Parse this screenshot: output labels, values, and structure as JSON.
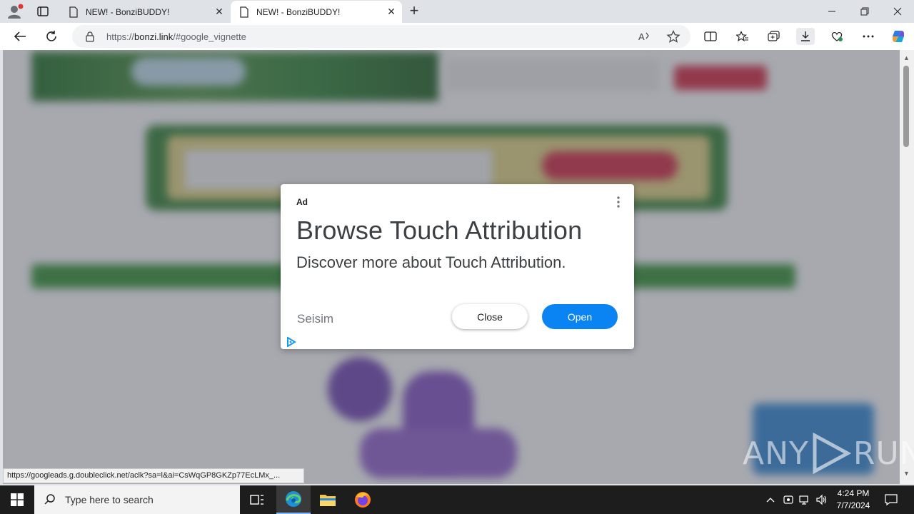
{
  "browser": {
    "tabs": [
      {
        "title": "NEW! - BonziBUDDY!",
        "active": false
      },
      {
        "title": "NEW! - BonziBUDDY!",
        "active": true
      }
    ],
    "url_host": "bonzi.link",
    "url_prefix": "https://",
    "url_rest": "/#google_vignette",
    "status_link": "https://googleads.g.doubleclick.net/aclk?sa=l&ai=CsWqGP8GKZp77EcLMx_..."
  },
  "ad": {
    "label": "Ad",
    "headline": "Browse Touch Attribution",
    "description": "Discover more about Touch Attribution.",
    "advertiser": "Seisim",
    "close_label": "Close",
    "open_label": "Open"
  },
  "watermark": {
    "left": "ANY",
    "right": "RUN"
  },
  "taskbar": {
    "search_placeholder": "Type here to search",
    "time": "4:24 PM",
    "date": "7/7/2024"
  },
  "colors": {
    "open_button": "#0b84f3",
    "taskbar": "#1d1d1d",
    "tabstrip": "#dfe3e8"
  }
}
